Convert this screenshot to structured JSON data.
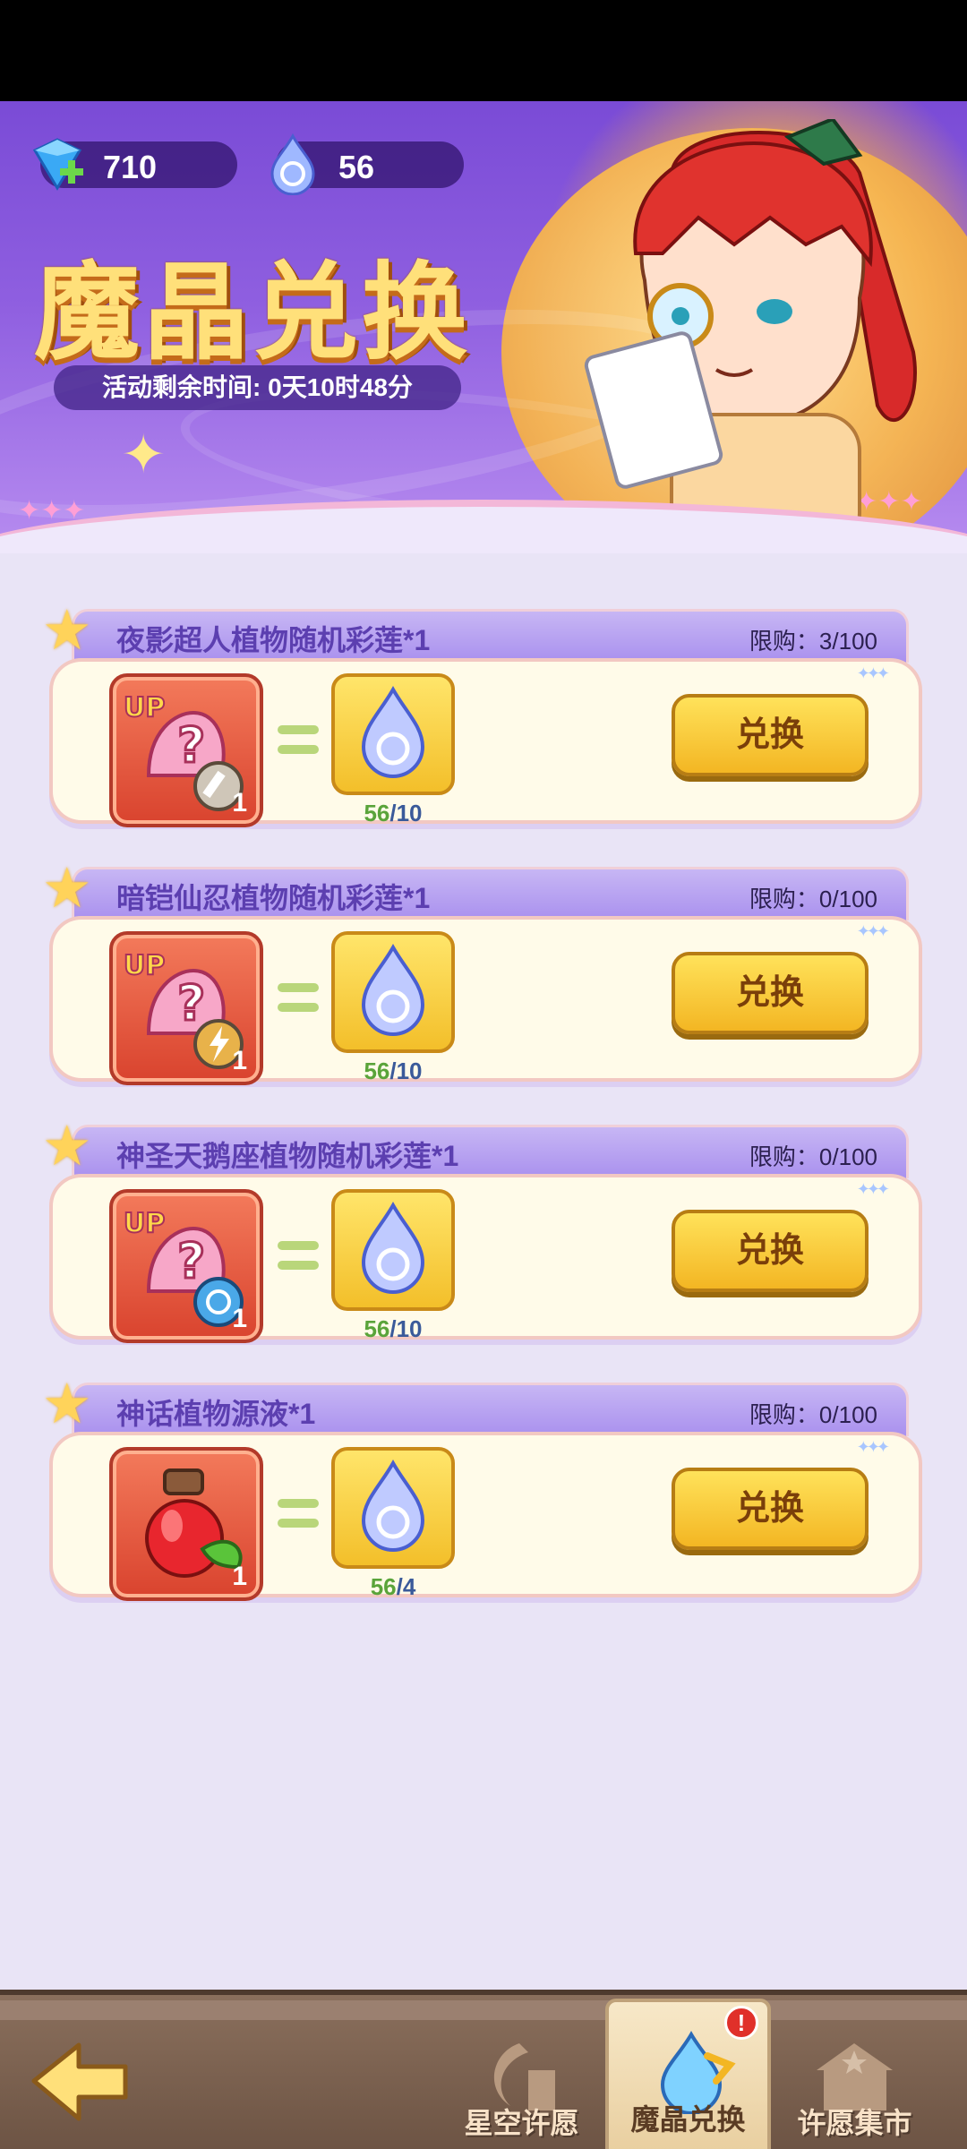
{
  "currencies": {
    "gem": {
      "value": "710",
      "icon": "gem-plus-icon"
    },
    "crystal": {
      "value": "56",
      "icon": "magic-crystal-drop-icon"
    }
  },
  "banner": {
    "title": "魔晶兑换",
    "timer": "活动剩余时间: 0天10时48分"
  },
  "items": [
    {
      "name": "夜影超人植物随机彩莲*1",
      "limit": "限购：3/100",
      "have": "56",
      "need": "/10",
      "button": "兑换",
      "reward_icon": "up-mystery-lotus-sword-icon"
    },
    {
      "name": "暗铠仙忍植物随机彩莲*1",
      "limit": "限购：0/100",
      "have": "56",
      "need": "/10",
      "button": "兑换",
      "reward_icon": "up-mystery-lotus-lightning-icon"
    },
    {
      "name": "神圣天鹅座植物随机彩莲*1",
      "limit": "限购：0/100",
      "have": "56",
      "need": "/10",
      "button": "兑换",
      "reward_icon": "up-mystery-lotus-water-icon"
    },
    {
      "name": "神话植物源液*1",
      "limit": "限购：0/100",
      "have": "56",
      "need": "/4",
      "button": "兑换",
      "reward_icon": "myth-plant-essence-potion-icon"
    }
  ],
  "reward_quantity": "1",
  "nav": {
    "tabs": [
      {
        "label": "星空许愿",
        "icon": "star-wish-icon"
      },
      {
        "label": "魔晶兑换",
        "icon": "magic-crystal-exchange-icon",
        "active": true,
        "alert": "!"
      },
      {
        "label": "许愿集市",
        "icon": "wish-market-icon"
      }
    ]
  },
  "colors": {
    "accent_purple": "#a990ee",
    "button_yellow": "#f3b623",
    "card_bg": "#fffbe9"
  }
}
